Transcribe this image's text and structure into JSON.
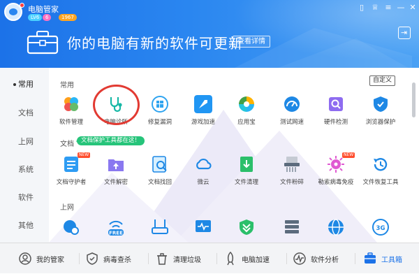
{
  "app": {
    "title": "电脑管家",
    "badges": [
      "LV6",
      "6",
      "1967"
    ]
  },
  "banner": {
    "message": "你的电脑有新的软件可更新",
    "detail_button": "查看详情"
  },
  "sidebar": {
    "items": [
      {
        "label": "常用",
        "active": true
      },
      {
        "label": "文档",
        "active": false
      },
      {
        "label": "上网",
        "active": false
      },
      {
        "label": "系统",
        "active": false
      },
      {
        "label": "软件",
        "active": false
      },
      {
        "label": "其他",
        "active": false
      }
    ]
  },
  "content": {
    "customize_button": "自定义",
    "sections": [
      {
        "title": "常用",
        "tools": [
          {
            "label": "软件管理",
            "icon": "software-manager-icon"
          },
          {
            "label": "电脑诊所",
            "icon": "stethoscope-icon"
          },
          {
            "label": "修复漏洞",
            "icon": "windows-repair-icon"
          },
          {
            "label": "游戏加速",
            "icon": "rocket-icon"
          },
          {
            "label": "应用宝",
            "icon": "app-store-icon"
          },
          {
            "label": "测试网速",
            "icon": "speedometer-icon"
          },
          {
            "label": "硬件检测",
            "icon": "chip-scan-icon"
          },
          {
            "label": "浏览器保护",
            "icon": "browser-shield-icon"
          }
        ]
      },
      {
        "title": "文档",
        "tip": "文档保护工具都在这！",
        "tools": [
          {
            "label": "文档守护者",
            "icon": "document-guard-icon",
            "badge": "NEW"
          },
          {
            "label": "文件解密",
            "icon": "folder-decrypt-icon"
          },
          {
            "label": "文档找回",
            "icon": "document-recover-icon"
          },
          {
            "label": "微云",
            "icon": "cloud-icon"
          },
          {
            "label": "文件清理",
            "icon": "file-clean-icon"
          },
          {
            "label": "文件粉碎",
            "icon": "shredder-icon"
          },
          {
            "label": "勒索病毒免疫",
            "icon": "virus-immune-icon",
            "badge": "NEW"
          },
          {
            "label": "文件恢复工具",
            "icon": "file-restore-icon"
          }
        ]
      },
      {
        "title": "上网",
        "tools": [
          {
            "label": "",
            "icon": "network-globe-icon"
          },
          {
            "label": "",
            "icon": "free-wifi-icon",
            "badge_text": "FREE"
          },
          {
            "label": "",
            "icon": "router-icon"
          },
          {
            "label": "",
            "icon": "network-monitor-icon"
          },
          {
            "label": "",
            "icon": "shield-down-icon"
          },
          {
            "label": "",
            "icon": "server-icon"
          },
          {
            "label": "",
            "icon": "globe-icon"
          },
          {
            "label": "",
            "icon": "3g-icon",
            "badge_text": "3G"
          }
        ]
      }
    ]
  },
  "bottom_tabs": [
    {
      "label": "我的管家",
      "icon": "butler-icon",
      "active": false
    },
    {
      "label": "病毒查杀",
      "icon": "virus-kill-icon",
      "active": false
    },
    {
      "label": "清理垃圾",
      "icon": "trash-clean-icon",
      "active": false
    },
    {
      "label": "电脑加速",
      "icon": "rocket-boost-icon",
      "active": false
    },
    {
      "label": "软件分析",
      "icon": "software-analysis-icon",
      "active": false
    },
    {
      "label": "工具箱",
      "icon": "toolbox-icon",
      "active": true
    }
  ],
  "colors": {
    "accent": "#1c72e8",
    "green": "#26c47a",
    "red": "#e23a32"
  }
}
